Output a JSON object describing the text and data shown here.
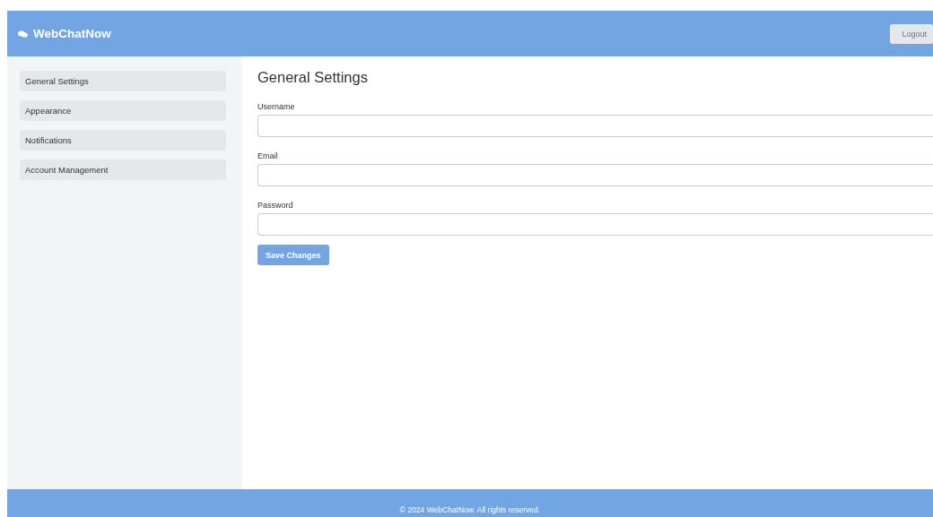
{
  "header": {
    "brand": "WebChatNow",
    "logout": "Logout"
  },
  "sidebar": {
    "items": [
      {
        "label": "General Settings"
      },
      {
        "label": "Appearance"
      },
      {
        "label": "Notifications"
      },
      {
        "label": "Account Management"
      }
    ]
  },
  "main": {
    "title": "General Settings",
    "fields": [
      {
        "label": "Username"
      },
      {
        "label": "Email"
      },
      {
        "label": "Password"
      }
    ],
    "button": "Save Changes"
  },
  "footer": "© 2024 WebChatNow. All rights reserved."
}
